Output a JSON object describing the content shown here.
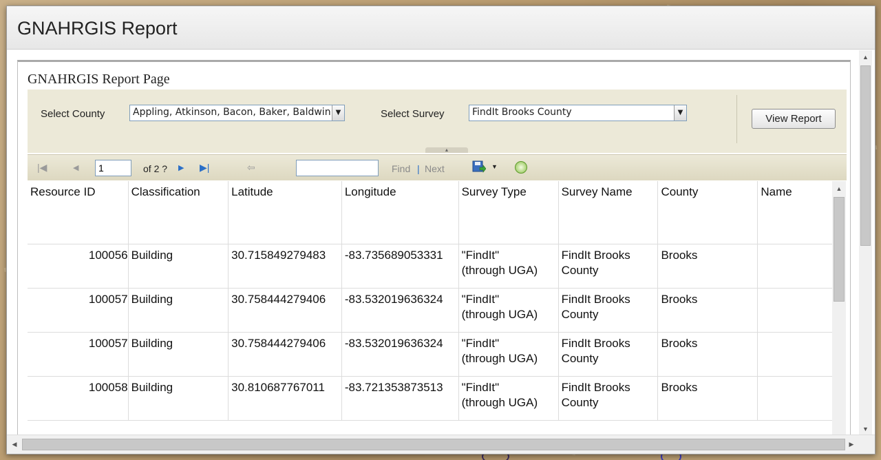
{
  "dialog": {
    "title": "GNAHRGIS Report"
  },
  "report": {
    "page_title": "GNAHRGIS Report Page",
    "params": {
      "county_label": "Select County",
      "county_value": "Appling, Atkinson, Bacon, Baker, Baldwin",
      "survey_label": "Select Survey",
      "survey_value": "FindIt Brooks County",
      "view_report_label": "View Report"
    },
    "toolbar": {
      "page_number": "1",
      "page_of": "of 2 ?",
      "find_label": "Find",
      "separator": "|",
      "next_label": "Next",
      "icons": [
        "first-page-icon",
        "previous-page-icon",
        "next-page-icon",
        "last-page-icon",
        "back-icon",
        "export-icon",
        "refresh-icon"
      ]
    },
    "table": {
      "columns": [
        "Resource ID",
        "Classification",
        "Latitude",
        "Longitude",
        "Survey Type",
        "Survey Name",
        "County",
        "Name"
      ],
      "rows": [
        {
          "id": "100056",
          "classification": "Building",
          "lat": "30.715849279483",
          "lon": "-83.735689053331",
          "survey_type_1": "\"FindIt\"",
          "survey_type_2": "(through UGA)",
          "survey_name_1": "FindIt Brooks",
          "survey_name_2": "County",
          "county": "Brooks",
          "name": ""
        },
        {
          "id": "100057",
          "classification": "Building",
          "lat": "30.758444279406",
          "lon": "-83.532019636324",
          "survey_type_1": "\"FindIt\"",
          "survey_type_2": "(through UGA)",
          "survey_name_1": "FindIt Brooks",
          "survey_name_2": "County",
          "county": "Brooks",
          "name": ""
        },
        {
          "id": "100057",
          "classification": "Building",
          "lat": "30.758444279406",
          "lon": "-83.532019636324",
          "survey_type_1": "\"FindIt\"",
          "survey_type_2": "(through UGA)",
          "survey_name_1": "FindIt Brooks",
          "survey_name_2": "County",
          "county": "Brooks",
          "name": ""
        },
        {
          "id": "100058",
          "classification": "Building",
          "lat": "30.810687767011",
          "lon": "-83.721353873513",
          "survey_type_1": "\"FindIt\"",
          "survey_type_2": "(through UGA)",
          "survey_name_1": "FindIt Brooks",
          "survey_name_2": "County",
          "county": "Brooks",
          "name": ""
        }
      ]
    }
  },
  "colors": {
    "param_bar": "#ece9d8",
    "link_blue": "#2b6fc7"
  }
}
